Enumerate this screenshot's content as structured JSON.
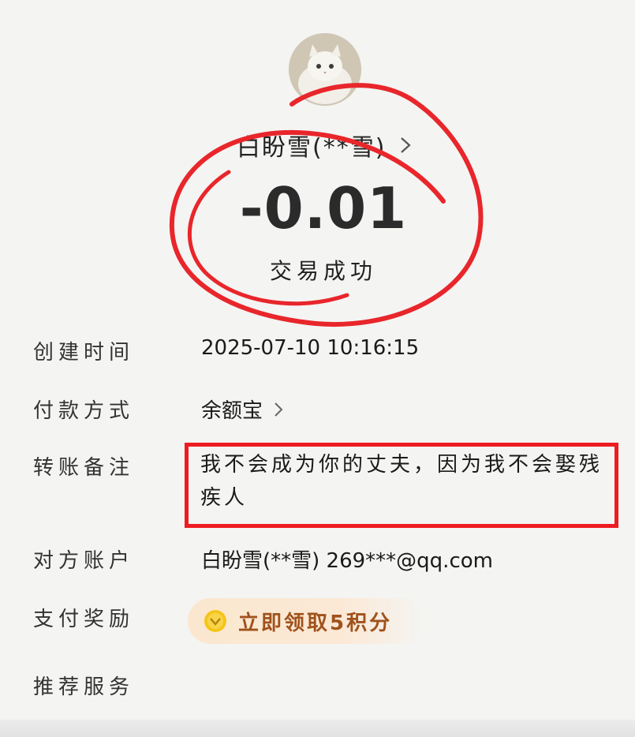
{
  "header": {
    "recipient": "白盼雪(**雪)",
    "amount": "-0.01",
    "status": "交易成功"
  },
  "details": [
    {
      "label": "创建时间",
      "value": "2025-07-10 10:16:15"
    },
    {
      "label": "付款方式",
      "value": "余额宝"
    },
    {
      "label": "转账备注",
      "value": "我不会成为你的丈夫，因为我不会娶残疾人"
    },
    {
      "label": "对方账户",
      "value": "白盼雪(**雪) 269***@qq.com"
    },
    {
      "label": "支付奖励",
      "value": "立即领取5积分"
    },
    {
      "label": "推荐服务",
      "value": ""
    }
  ],
  "icons": {
    "avatar": "white-cat-avatar",
    "recipient_chevron": "chevron-right-icon",
    "payment_chevron": "chevron-right-icon",
    "reward_coin": "coin-icon"
  },
  "colors": {
    "annotation_red": "#ee1c22",
    "reward_text": "#a0521c",
    "reward_bg": "#fbe7cf"
  }
}
